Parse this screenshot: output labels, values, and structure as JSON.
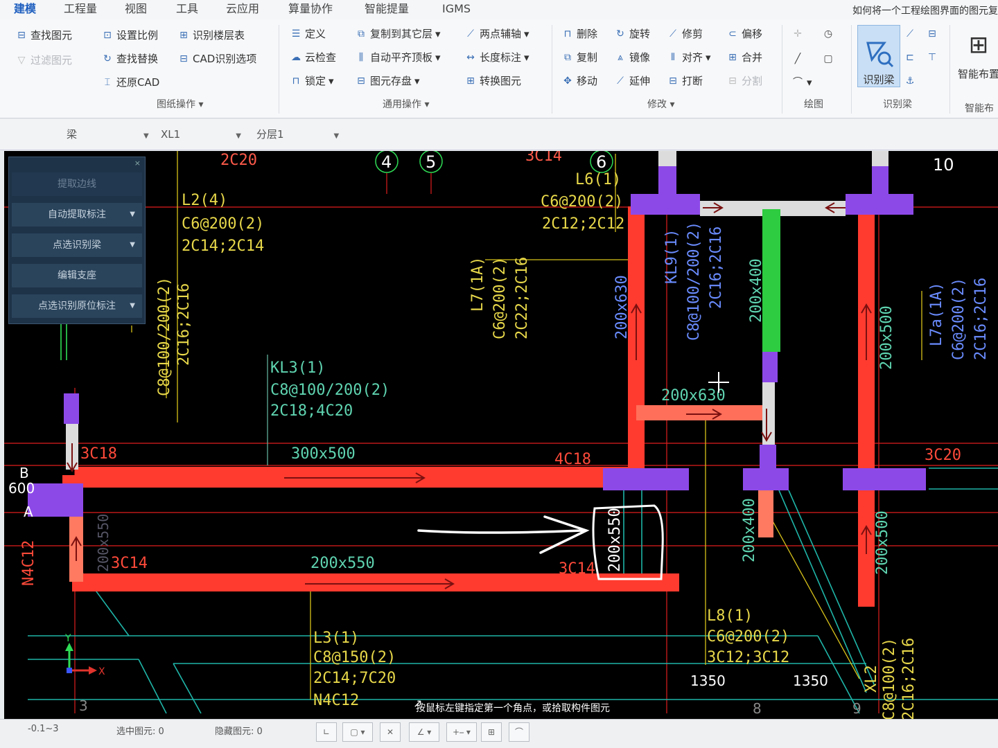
{
  "menu": {
    "tabs": [
      "建模",
      "工程量",
      "视图",
      "工具",
      "云应用",
      "算量协作",
      "智能提量",
      "IGMS"
    ],
    "active": "建模",
    "title_hint": "如何将一个工程绘图界面的图元复"
  },
  "ribbon": {
    "drawing_ops": {
      "label": "图纸操作",
      "find_element": "查找图元",
      "filter_element": "过滤图元",
      "set_scale": "设置比例",
      "identify_floor_table": "识别楼层表",
      "find_replace": "查找替换",
      "cad_options": "CAD识别选项",
      "restore_cad": "还原CAD"
    },
    "general_ops": {
      "label": "通用操作",
      "define": "定义",
      "copy_to_floor": "复制到其它层",
      "two_point_axis": "两点辅轴",
      "cloud_check": "云检查",
      "auto_slab": "自动平齐顶板",
      "length_dim": "长度标注",
      "lock": "锁定",
      "element_save": "图元存盘",
      "convert_element": "转换图元"
    },
    "modify": {
      "label": "修改",
      "delete": "删除",
      "rotate": "旋转",
      "trim": "修剪",
      "offset": "偏移",
      "copy": "复制",
      "mirror": "镜像",
      "align": "对齐",
      "merge": "合并",
      "move": "移动",
      "extend": "延伸",
      "break": "打断",
      "split": "分割"
    },
    "draw": {
      "label": "绘图"
    },
    "identify_beam": {
      "label": "识别梁",
      "button": "识别梁"
    },
    "smart_layout": {
      "label": "智能布",
      "button": "智能布置"
    }
  },
  "toolbar": {
    "element_type": "梁",
    "element_name": "XL1",
    "layer": "分层1"
  },
  "float_panel": {
    "items": [
      "提取边线",
      "自动提取标注",
      "点选识别梁",
      "编辑支座",
      "点选识别原位标注"
    ]
  },
  "cad_labels": {
    "axis_numbers": [
      "4",
      "5",
      "6",
      "10",
      "3",
      "8",
      "9"
    ],
    "axis_letters": [
      "B",
      "A"
    ],
    "l2": [
      "L2(4)",
      "C6@200(2)",
      "2C14;2C14"
    ],
    "l6": [
      "L6(1)",
      "C6@200(2)",
      "2C12;2C12"
    ],
    "l7": [
      "L7(1A)",
      "C6@200(2)",
      "2C22;2C16"
    ],
    "kl3": [
      "KL3(1)",
      "C8@100/200(2)",
      "2C18;4C20"
    ],
    "kl9": [
      "KL9(1)",
      "C8@100/200(2)",
      "2C16;2C16"
    ],
    "l3": [
      "L3(1)",
      "C8@150(2)",
      "2C14;7C20",
      "N4C12"
    ],
    "l8": [
      "L8(1)",
      "C6@200(2)",
      "3C12;3C12"
    ],
    "l7a": [
      "L7a(1A)",
      "C6@200(2)",
      "2C16;2C16"
    ],
    "xl2": [
      "XL2",
      "C8@100(2)",
      "2C16;2C16"
    ],
    "left_stirrup": [
      "C8@100/200(2)",
      "2C16;2C16"
    ],
    "top_rebar": "2C20",
    "top_rebar2": "3C14",
    "size_300x500": "300x500",
    "size_200x550_a": "200x550",
    "size_200x550_b": "200x550",
    "size_200x550_c": "200x550",
    "size_200x630_a": "200x630",
    "size_200x630_b": "200x630",
    "size_200x400_a": "200x400",
    "size_200x400_b": "200x400",
    "size_200x500_a": "200x500",
    "size_200x500_b": "200x500",
    "rebar_3c18": "3C18",
    "rebar_4c18": "4C18",
    "rebar_3c20": "3C20",
    "rebar_3c14a": "3C14",
    "rebar_3c14b": "3C14",
    "rebar_n4c12": "N4C12",
    "dim_600": "600",
    "dim_1350a": "1350",
    "dim_1350b": "1350",
    "axis_x": "X",
    "axis_y": "Y"
  },
  "prompt": "按鼠标左键指定第一个角点，或拾取构件图元",
  "status": {
    "elevation": "-0.1~3",
    "selected_label": "选中图元:",
    "selected_count": "0",
    "hidden_label": "隐藏图元:",
    "hidden_count": "0"
  }
}
